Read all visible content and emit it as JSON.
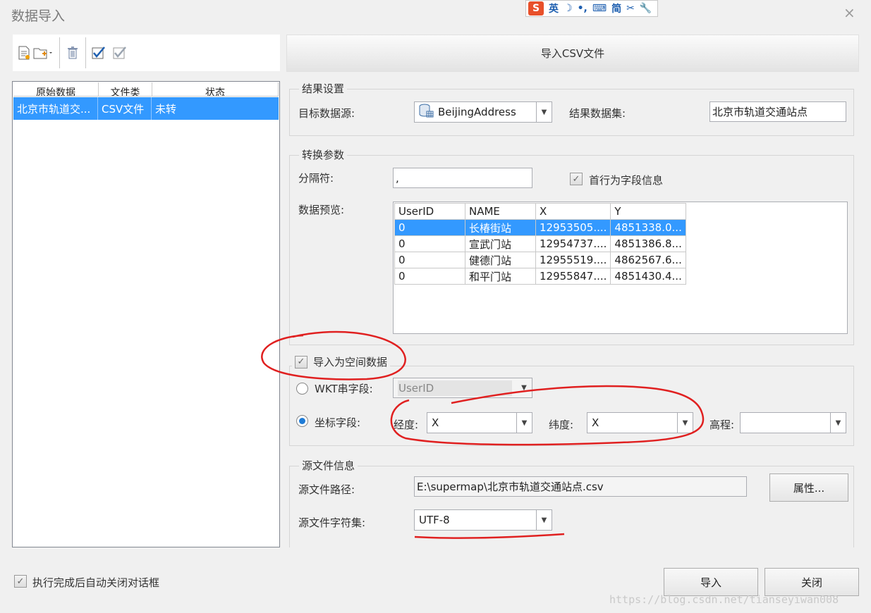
{
  "window": {
    "title": "数据导入",
    "close_glyph": "×"
  },
  "ime_bar": {
    "logo": "S",
    "items": [
      "英",
      "☽",
      "•,",
      "⌨",
      "简",
      "✂",
      "🔧"
    ]
  },
  "toolbar": {
    "icons": [
      "new-file-icon",
      "add-folder-icon",
      "delete-icon",
      "select-all-icon",
      "invert-select-icon"
    ]
  },
  "header": {
    "title": "导入CSV文件"
  },
  "file_list": {
    "columns": [
      "原始数据",
      "文件类",
      "状态"
    ],
    "rows": [
      {
        "name": "北京市轨道交...",
        "type": "CSV文件",
        "status": "未转"
      }
    ]
  },
  "result_settings": {
    "group_label": "结果设置",
    "datasource_label": "目标数据源:",
    "datasource_value": "BeijingAddress",
    "dataset_label": "结果数据集:",
    "dataset_value": "北京市轨道交通站点"
  },
  "convert_params": {
    "group_label": "转换参数",
    "separator_label": "分隔符:",
    "separator_value": ",",
    "first_row_label": "首行为字段信息",
    "preview_label": "数据预览:",
    "preview_columns": [
      "UserID",
      "NAME",
      "X",
      "Y"
    ],
    "preview_rows": [
      [
        "0",
        "长椿街站",
        "12953505....",
        "4851338.0..."
      ],
      [
        "0",
        "宣武门站",
        "12954737....",
        "4851386.8..."
      ],
      [
        "0",
        "健德门站",
        "12955519....",
        "4862567.6..."
      ],
      [
        "0",
        "和平门站",
        "12955847....",
        "4851430.4..."
      ]
    ]
  },
  "spatial": {
    "import_label": "导入为空间数据",
    "wkt_label": "WKT串字段:",
    "wkt_value": "UserID",
    "coord_label": "坐标字段:",
    "lon_label": "经度:",
    "lon_value": "X",
    "lat_label": "纬度:",
    "lat_value": "X",
    "elev_label": "高程:",
    "elev_value": ""
  },
  "source_info": {
    "group_label": "源文件信息",
    "path_label": "源文件路径:",
    "path_value": "E:\\supermap\\北京市轨道交通站点.csv",
    "props_button": "属性...",
    "charset_label": "源文件字符集:",
    "charset_value": "UTF-8"
  },
  "footer": {
    "auto_close_label": "执行完成后自动关闭对话框",
    "import_button": "导入",
    "close_button": "关闭"
  },
  "watermark": "https://blog.csdn.net/tianseyiwan008"
}
